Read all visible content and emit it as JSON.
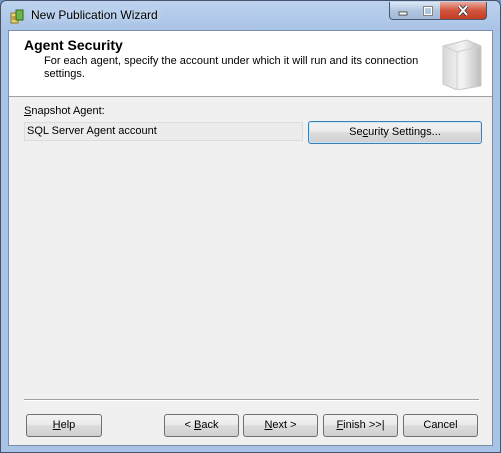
{
  "window": {
    "title": "New Publication Wizard"
  },
  "header": {
    "title": "Agent Security",
    "description": "For each agent, specify the account under which it will run and its connection settings."
  },
  "snapshot_agent": {
    "label_accesskey": "S",
    "label_rest": "napshot Agent:",
    "account": "SQL Server Agent account",
    "security_button": {
      "pre": "Se",
      "key": "c",
      "post": "urity Settings..."
    }
  },
  "footer": {
    "help": {
      "pre": "",
      "key": "H",
      "post": "elp"
    },
    "back": {
      "pre": "< ",
      "key": "B",
      "post": "ack"
    },
    "next": {
      "pre": "",
      "key": "N",
      "post": "ext >"
    },
    "finish": {
      "pre": "",
      "key": "F",
      "post": "inish >>|"
    },
    "cancel": {
      "pre": "Cancel",
      "key": "",
      "post": ""
    }
  },
  "colors": {
    "title_bar": "#a9c3e6",
    "close_button": "#c13d24",
    "focus_border": "#3c7fb1"
  }
}
